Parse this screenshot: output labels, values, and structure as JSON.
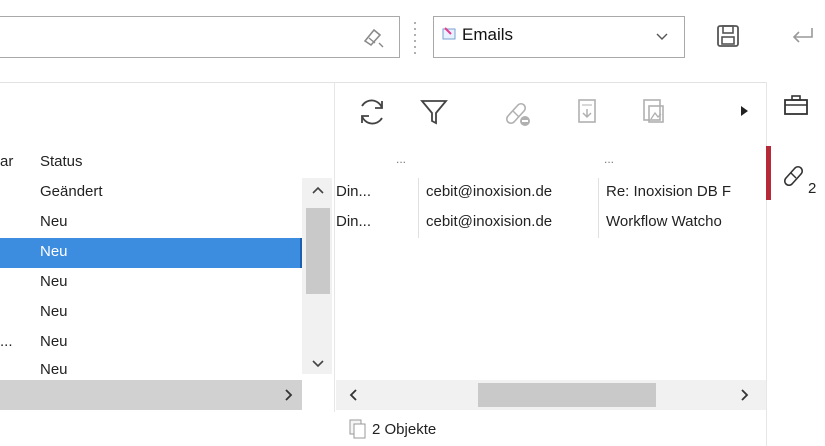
{
  "toolbar": {
    "search": {
      "value": "",
      "placeholder": ""
    },
    "type_combo": {
      "selected": "Emails"
    }
  },
  "left_table": {
    "header_prefix": "ar",
    "header_status": "Status",
    "rows": [
      {
        "prefix": "",
        "status": "Geändert"
      },
      {
        "prefix": "",
        "status": "Neu"
      },
      {
        "prefix": "",
        "status": "Neu",
        "selected": true
      },
      {
        "prefix": "",
        "status": "Neu"
      },
      {
        "prefix": "",
        "status": "Neu"
      },
      {
        "prefix": "...",
        "status": "Neu"
      },
      {
        "prefix": "",
        "status": "Neu"
      }
    ]
  },
  "right_table": {
    "header_ellipsis_1": "...",
    "header_ellipsis_2": "...",
    "rows": [
      {
        "col1": "Din...",
        "col2": "cebit@inoxision.de",
        "col3": "Re: Inoxision DB F"
      },
      {
        "col1": "Din...",
        "col2": "cebit@inoxision.de",
        "col3": "Workflow Watcho"
      }
    ]
  },
  "status_bar": {
    "objects_text": "2 Objekte"
  },
  "side_panel": {
    "link_count": "2",
    "accent_color": "#b52a36"
  },
  "colors": {
    "selection": "#3c8ce0",
    "scroll_thumb": "#c9c9c9"
  },
  "icons": [
    "eraser-icon",
    "grip-icon",
    "email-type-icon",
    "chevron-down-icon",
    "save-icon",
    "return-icon",
    "refresh-icon",
    "filter-icon",
    "unlink-icon",
    "export-icon",
    "image-export-icon",
    "more-arrow-icon",
    "briefcase-icon",
    "link-icon",
    "objects-icon"
  ]
}
